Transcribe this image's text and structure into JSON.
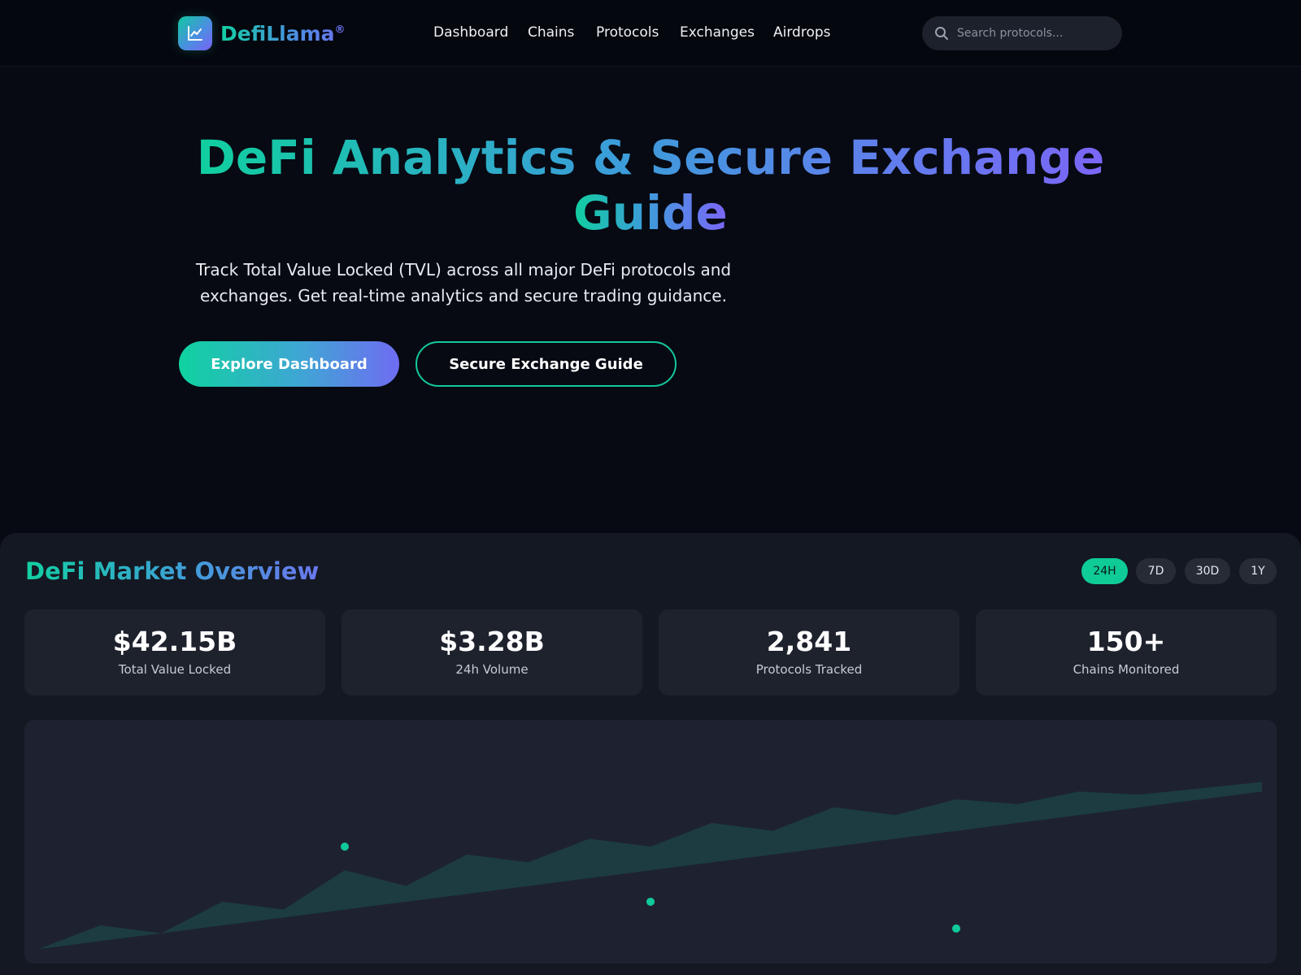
{
  "header": {
    "logo_text": "DefiLlama",
    "logo_mark": "®",
    "logo_icon": "chart-line-icon",
    "nav": [
      "Dashboard",
      "Chains",
      "Protocols",
      "Exchanges",
      "Airdrops"
    ],
    "search_placeholder": "Search protocols...",
    "search_icon": "search-icon"
  },
  "hero": {
    "title_line1": "DeFi Analytics & Secure Exchange",
    "title_line2": "Guide",
    "subtitle": "Track Total Value Locked (TVL) across all major DeFi protocols and exchanges. Get real-time analytics and secure trading guidance.",
    "primary_button": "Explore Dashboard",
    "secondary_button": "Secure Exchange Guide"
  },
  "overview": {
    "title": "DeFi Market Overview",
    "periods": [
      "24H",
      "7D",
      "30D",
      "1Y"
    ],
    "active_period": "24H",
    "stats": [
      {
        "value": "$42.15B",
        "label": "Total Value Locked"
      },
      {
        "value": "$3.28B",
        "label": "24h Volume"
      },
      {
        "value": "2,841",
        "label": "Protocols Tracked"
      },
      {
        "value": "150+",
        "label": "Chains Monitored"
      }
    ]
  },
  "colors": {
    "accent": "#10c99c",
    "accent_violet": "#7366f3",
    "background": "#070a13",
    "panel": "#141822",
    "card": "#1e222d"
  },
  "chart_data": {
    "type": "area",
    "x": [
      0,
      1,
      2,
      3,
      4,
      5,
      6,
      7,
      8,
      9,
      10,
      11,
      12,
      13,
      14,
      15,
      16,
      17,
      18,
      19,
      20
    ],
    "values": [
      0,
      15,
      10,
      30,
      25,
      50,
      40,
      60,
      55,
      70,
      65,
      80,
      75,
      90,
      85,
      95,
      92,
      100,
      98,
      102,
      106
    ],
    "baseline": [
      0,
      5,
      10,
      15,
      20,
      25,
      30,
      35,
      40,
      45,
      50,
      55,
      60,
      65,
      70,
      75,
      80,
      85,
      90,
      95,
      100
    ],
    "markers": [
      {
        "x": 5,
        "y": 65
      },
      {
        "x": 10,
        "y": 30
      },
      {
        "x": 15,
        "y": 13
      }
    ],
    "ylim": [
      0,
      130
    ],
    "grid": false,
    "series_color": "#10c99c"
  }
}
